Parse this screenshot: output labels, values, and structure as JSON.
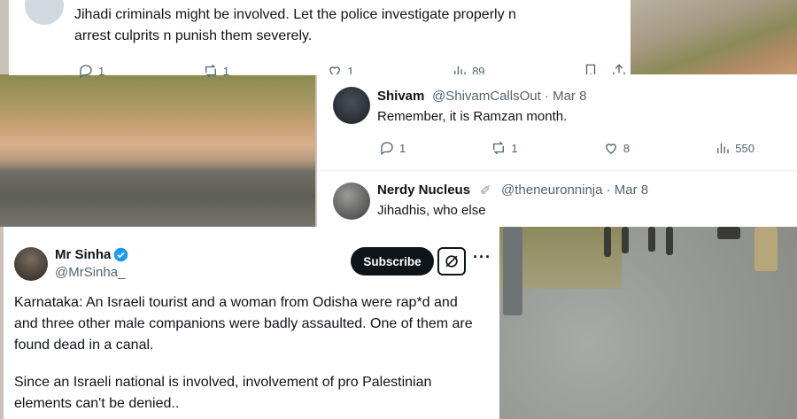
{
  "tweet1": {
    "text_line1": "Jihadi criminals might be involved. Let the police investigate properly n",
    "text_line2": "arrest culprits n punish them severely.",
    "replies": "1",
    "reposts": "1",
    "likes": "1",
    "views": "89"
  },
  "tweet2": {
    "name": "Shivam",
    "handle": "@ShivamCallsOut · Mar 8",
    "text": "Remember, it is Ramzan month.",
    "replies": "1",
    "reposts": "1",
    "likes": "8",
    "views": "550"
  },
  "tweet3": {
    "name": "Nerdy Nucleus",
    "name_emoji": "✐",
    "handle": "@theneuronninja · Mar 8",
    "text": "Jihadhis, who else"
  },
  "tweet4": {
    "name": "Mr Sinha",
    "handle": "@MrSinha_",
    "subscribe_label": "Subscribe",
    "more_label": "···",
    "para1_line1": "Karnataka: An Israeli tourist and a woman from Odisha were rap*d and",
    "para1_line2": "and three other male companions were badly assaulted. One of them are",
    "para1_line3": "found dead in a canal.",
    "para2_line1": "Since an Israeli national is involved, involvement of pro Palestinian",
    "para2_line2": "elements can't be denied.."
  },
  "colors": {
    "text": "#0f1419",
    "muted": "#536471",
    "verified": "#1d9bf0",
    "button_bg": "#0f1419"
  },
  "icons": [
    "reply-icon",
    "repost-icon",
    "like-icon",
    "views-icon",
    "bookmark-icon",
    "share-icon",
    "verified-badge-icon",
    "grok-icon",
    "more-icon"
  ]
}
